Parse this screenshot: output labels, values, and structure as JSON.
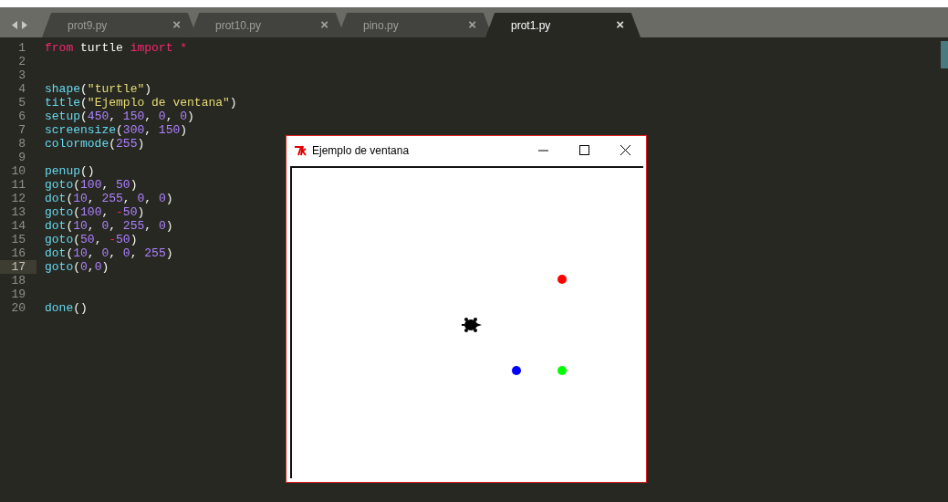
{
  "tabs": [
    {
      "label": "prot9.py",
      "close": "×",
      "selected": false
    },
    {
      "label": "prot10.py",
      "close": "×",
      "selected": false
    },
    {
      "label": "pino.py",
      "close": "×",
      "selected": false
    },
    {
      "label": "prot1.py",
      "close": "×",
      "selected": true
    }
  ],
  "editor": {
    "lines": [
      {
        "number": "1",
        "current": false,
        "tokens": [
          {
            "kind": "keyword",
            "text": "from"
          },
          {
            "kind": "plain",
            "text": " turtle "
          },
          {
            "kind": "keyword",
            "text": "import"
          },
          {
            "kind": "keyword",
            "text": " *"
          }
        ]
      },
      {
        "number": "2",
        "current": false
      },
      {
        "number": "3",
        "current": false
      },
      {
        "number": "4",
        "current": false,
        "tokens": [
          {
            "kind": "func",
            "text": "shape"
          },
          {
            "kind": "plain",
            "text": "("
          },
          {
            "kind": "string",
            "text": "\"turtle\""
          },
          {
            "kind": "plain",
            "text": ")"
          }
        ]
      },
      {
        "number": "5",
        "current": false,
        "tokens": [
          {
            "kind": "func",
            "text": "title"
          },
          {
            "kind": "plain",
            "text": "("
          },
          {
            "kind": "string",
            "text": "\"Ejemplo de ventana\""
          },
          {
            "kind": "plain",
            "text": ")"
          }
        ]
      },
      {
        "number": "6",
        "current": false,
        "tokens": [
          {
            "kind": "func",
            "text": "setup"
          },
          {
            "kind": "plain",
            "text": "("
          },
          {
            "kind": "number",
            "text": "450"
          },
          {
            "kind": "plain",
            "text": ", "
          },
          {
            "kind": "number",
            "text": "150"
          },
          {
            "kind": "plain",
            "text": ", "
          },
          {
            "kind": "number",
            "text": "0"
          },
          {
            "kind": "plain",
            "text": ", "
          },
          {
            "kind": "number",
            "text": "0"
          },
          {
            "kind": "plain",
            "text": ")"
          }
        ]
      },
      {
        "number": "7",
        "current": false,
        "tokens": [
          {
            "kind": "func",
            "text": "screensize"
          },
          {
            "kind": "plain",
            "text": "("
          },
          {
            "kind": "number",
            "text": "300"
          },
          {
            "kind": "plain",
            "text": ", "
          },
          {
            "kind": "number",
            "text": "150"
          },
          {
            "kind": "plain",
            "text": ")"
          }
        ]
      },
      {
        "number": "8",
        "current": false,
        "tokens": [
          {
            "kind": "func",
            "text": "colormode"
          },
          {
            "kind": "plain",
            "text": "("
          },
          {
            "kind": "number",
            "text": "255"
          },
          {
            "kind": "plain",
            "text": ")"
          }
        ]
      },
      {
        "number": "9",
        "current": false
      },
      {
        "number": "10",
        "current": false,
        "tokens": [
          {
            "kind": "func",
            "text": "penup"
          },
          {
            "kind": "plain",
            "text": "()"
          }
        ]
      },
      {
        "number": "11",
        "current": false,
        "tokens": [
          {
            "kind": "func",
            "text": "goto"
          },
          {
            "kind": "plain",
            "text": "("
          },
          {
            "kind": "number",
            "text": "100"
          },
          {
            "kind": "plain",
            "text": ", "
          },
          {
            "kind": "number",
            "text": "50"
          },
          {
            "kind": "plain",
            "text": ")"
          }
        ]
      },
      {
        "number": "12",
        "current": false,
        "tokens": [
          {
            "kind": "func",
            "text": "dot"
          },
          {
            "kind": "plain",
            "text": "("
          },
          {
            "kind": "number",
            "text": "10"
          },
          {
            "kind": "plain",
            "text": ", "
          },
          {
            "kind": "number",
            "text": "255"
          },
          {
            "kind": "plain",
            "text": ", "
          },
          {
            "kind": "number",
            "text": "0"
          },
          {
            "kind": "plain",
            "text": ", "
          },
          {
            "kind": "number",
            "text": "0"
          },
          {
            "kind": "plain",
            "text": ")"
          }
        ]
      },
      {
        "number": "13",
        "current": false,
        "tokens": [
          {
            "kind": "func",
            "text": "goto"
          },
          {
            "kind": "plain",
            "text": "("
          },
          {
            "kind": "number",
            "text": "100"
          },
          {
            "kind": "plain",
            "text": ", "
          },
          {
            "kind": "keyword",
            "text": "-"
          },
          {
            "kind": "number",
            "text": "50"
          },
          {
            "kind": "plain",
            "text": ")"
          }
        ]
      },
      {
        "number": "14",
        "current": false,
        "tokens": [
          {
            "kind": "func",
            "text": "dot"
          },
          {
            "kind": "plain",
            "text": "("
          },
          {
            "kind": "number",
            "text": "10"
          },
          {
            "kind": "plain",
            "text": ", "
          },
          {
            "kind": "number",
            "text": "0"
          },
          {
            "kind": "plain",
            "text": ", "
          },
          {
            "kind": "number",
            "text": "255"
          },
          {
            "kind": "plain",
            "text": ", "
          },
          {
            "kind": "number",
            "text": "0"
          },
          {
            "kind": "plain",
            "text": ")"
          }
        ]
      },
      {
        "number": "15",
        "current": false,
        "tokens": [
          {
            "kind": "func",
            "text": "goto"
          },
          {
            "kind": "plain",
            "text": "("
          },
          {
            "kind": "number",
            "text": "50"
          },
          {
            "kind": "plain",
            "text": ", "
          },
          {
            "kind": "keyword",
            "text": "-"
          },
          {
            "kind": "number",
            "text": "50"
          },
          {
            "kind": "plain",
            "text": ")"
          }
        ]
      },
      {
        "number": "16",
        "current": false,
        "tokens": [
          {
            "kind": "func",
            "text": "dot"
          },
          {
            "kind": "plain",
            "text": "("
          },
          {
            "kind": "number",
            "text": "10"
          },
          {
            "kind": "plain",
            "text": ", "
          },
          {
            "kind": "number",
            "text": "0"
          },
          {
            "kind": "plain",
            "text": ", "
          },
          {
            "kind": "number",
            "text": "0"
          },
          {
            "kind": "plain",
            "text": ", "
          },
          {
            "kind": "number",
            "text": "255"
          },
          {
            "kind": "plain",
            "text": ")"
          }
        ]
      },
      {
        "number": "17",
        "current": true,
        "tokens": [
          {
            "kind": "func",
            "text": "goto"
          },
          {
            "kind": "plain",
            "text": "("
          },
          {
            "kind": "number",
            "text": "0"
          },
          {
            "kind": "plain",
            "text": ","
          },
          {
            "kind": "number",
            "text": "0"
          },
          {
            "kind": "plain",
            "text": ")"
          }
        ]
      },
      {
        "number": "18",
        "current": false
      },
      {
        "number": "19",
        "current": false
      },
      {
        "number": "20",
        "current": false,
        "tokens": [
          {
            "kind": "func",
            "text": "done"
          },
          {
            "kind": "plain",
            "text": "()"
          }
        ]
      }
    ]
  },
  "turtle_window": {
    "title": "Ejemplo de ventana",
    "dots": [
      {
        "color": "#ff0000"
      },
      {
        "color": "#00ff00"
      },
      {
        "color": "#0000ff"
      }
    ]
  }
}
